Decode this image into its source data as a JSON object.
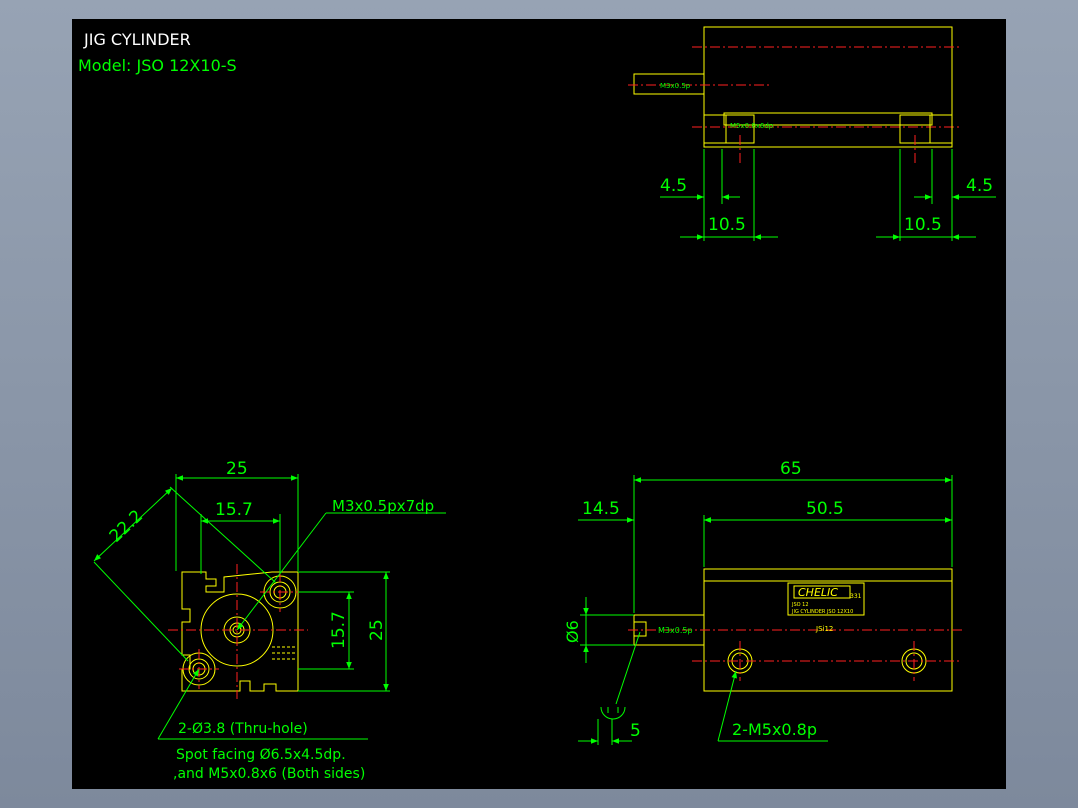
{
  "title_block": {
    "title": "JIG CYLINDER",
    "model": "Model: JSO 12X10-S"
  },
  "colors": {
    "background": "#000000",
    "outline": "#ffff00",
    "dimension": "#00ff00",
    "centerline": "#ff2020",
    "title": "#ffffff",
    "frame": "#8a96a8"
  },
  "top_view": {
    "port_label": "M3x0.5p",
    "inner_port_label": "M5x0.8x6dp",
    "dim_left_small": "4.5",
    "dim_left_large": "10.5",
    "dim_right_small": "4.5",
    "dim_right_large": "10.5"
  },
  "end_view": {
    "dim_width": "25",
    "dim_diag": "22.2",
    "dim_inner": "15.7",
    "dim_height": "25",
    "dim_height_inner": "15.7",
    "port_callout": "M3x0.5px7dp",
    "note_line1": "2-Ø3.8 (Thru-hole)",
    "note_line2": "Spot facing Ø6.5x4.5dp.",
    "note_line3": ",and M5x0.8x6 (Both sides)"
  },
  "side_view": {
    "dim_overall": "65",
    "dim_front": "14.5",
    "dim_body": "50.5",
    "dim_rod_dia": "Ø6",
    "dim_flats": "5",
    "port_label": "M3x0.5p",
    "mount_callout": "2-M5x0.8p",
    "brand": "CHELIC",
    "brand_suffix": "331",
    "label_line1": "JSO 12",
    "label_line2": "JIG CYLINDER JSO 12X10",
    "label_model": "JSi12"
  }
}
